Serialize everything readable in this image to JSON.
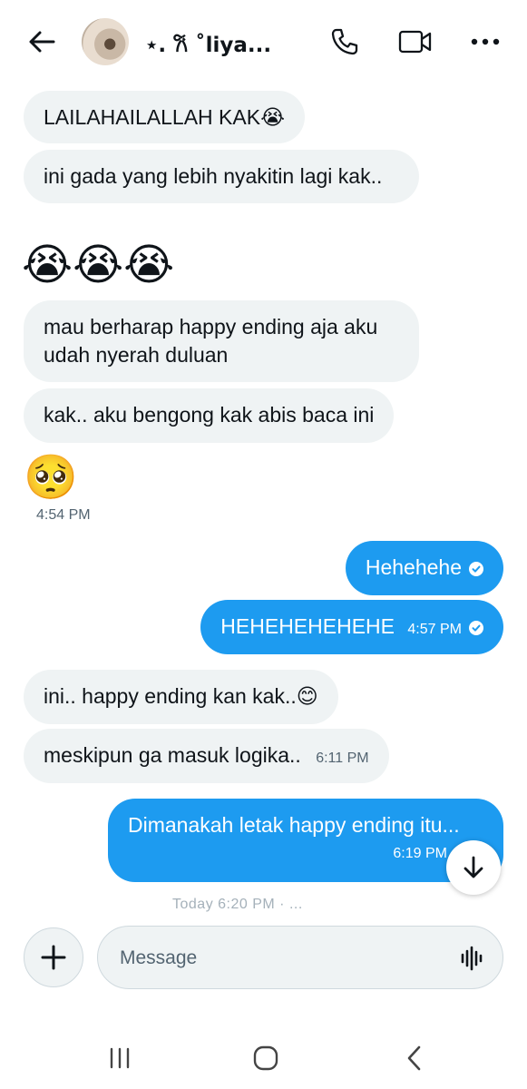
{
  "header": {
    "back_icon": "arrow-left-icon",
    "contact_name": "⋆. 𐙚 ˚liya...",
    "call_icon": "phone-icon",
    "video_icon": "video-camera-icon",
    "more_icon": "more-horizontal-icon"
  },
  "messages": [
    {
      "dir": "in",
      "text": "LAILAHAILALLAH KAK😭"
    },
    {
      "dir": "in",
      "text": "ini gada yang lebih nyakitin lagi kak.."
    },
    {
      "dir": "in",
      "emoji": "😭😭😭"
    },
    {
      "dir": "in",
      "text": "mau berharap happy ending aja aku udah nyerah duluan"
    },
    {
      "dir": "in",
      "text": "kak.. aku bengong kak abis baca ini"
    },
    {
      "dir": "in",
      "emoji": "🥺",
      "time": "4:54 PM"
    },
    {
      "dir": "out",
      "text": "Hehehehe",
      "seen": true
    },
    {
      "dir": "out",
      "text": "HEHEHEHEHEHE",
      "time": "4:57 PM",
      "seen": true
    },
    {
      "dir": "in",
      "text": "ini.. happy ending kan kak..😊"
    },
    {
      "dir": "in",
      "text": "meskipun ga masuk logika..",
      "time": "6:11 PM"
    },
    {
      "dir": "out",
      "text": "Dimanakah letak happy ending itu...",
      "time": "6:19 PM"
    }
  ],
  "faded_divider": "Today 6:20 PM · ...",
  "scroll_down_icon": "arrow-down-icon",
  "composer": {
    "add_icon": "plus-icon",
    "placeholder": "Message",
    "voice_icon": "voice-wave-icon"
  },
  "system_nav": {
    "recents_icon": "recents-icon",
    "home_icon": "home-icon",
    "back_icon": "nav-back-icon"
  },
  "colors": {
    "accent": "#1d9bf0",
    "incoming_bubble": "#eff3f4",
    "text": "#0f1419",
    "secondary_text": "#536471"
  }
}
